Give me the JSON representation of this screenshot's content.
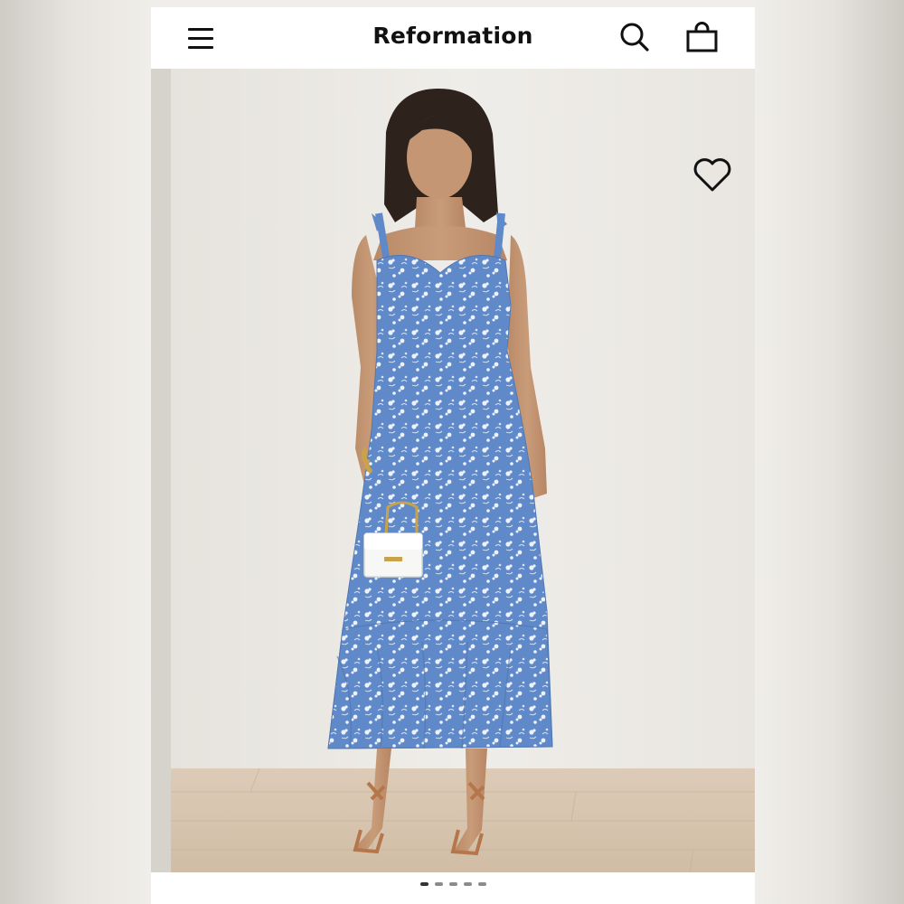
{
  "header": {
    "brand": "Reformation",
    "menu_icon": "hamburger-menu-icon",
    "search_icon": "search-icon",
    "bag_icon": "shopping-bag-icon"
  },
  "product": {
    "image_description_icon": "product-photo",
    "favorite_icon": "heart-outline-icon"
  },
  "carousel": {
    "total_slides": 5,
    "active_index": 0
  },
  "colors": {
    "header_bg": "#ffffff",
    "brand_text": "#111111",
    "dress_blue": "#5f89c9",
    "wall": "#edebe6",
    "floor": "#d7c4ae"
  }
}
